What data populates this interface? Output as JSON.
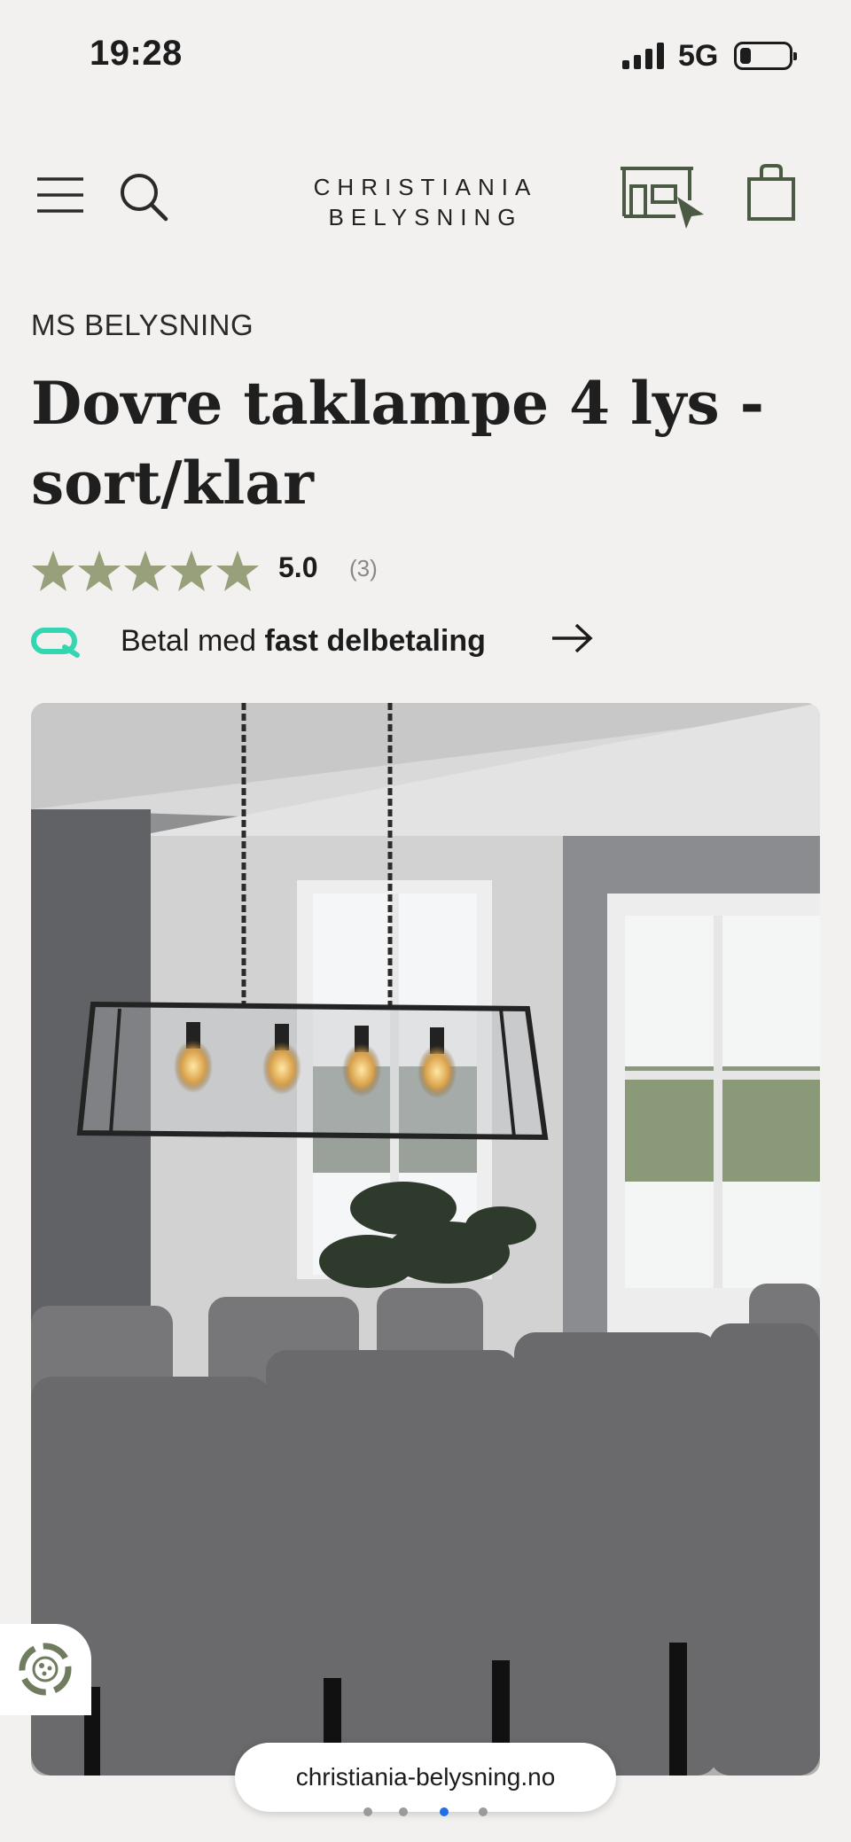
{
  "status_bar": {
    "time": "19:28",
    "network": "5G"
  },
  "header": {
    "logo_line1": "CHRISTIANIA",
    "logo_line2": "BELYSNING"
  },
  "product": {
    "brand": "MS BELYSNING",
    "title": "Dovre taklampe 4 lys - sort/klar",
    "rating": "5.0",
    "review_count": "(3)",
    "stars": 5
  },
  "payment": {
    "prefix": "Betal med ",
    "emphasis": "fast delbetaling"
  },
  "browser": {
    "url": "christiania-belysning.no"
  },
  "gallery": {
    "dot_count": 4,
    "active_dot": 3
  },
  "colors": {
    "accent_green": "#4a5a43",
    "star": "#97a07a",
    "klarna": "#33d6b0",
    "active_dot": "#1f6fe6"
  }
}
